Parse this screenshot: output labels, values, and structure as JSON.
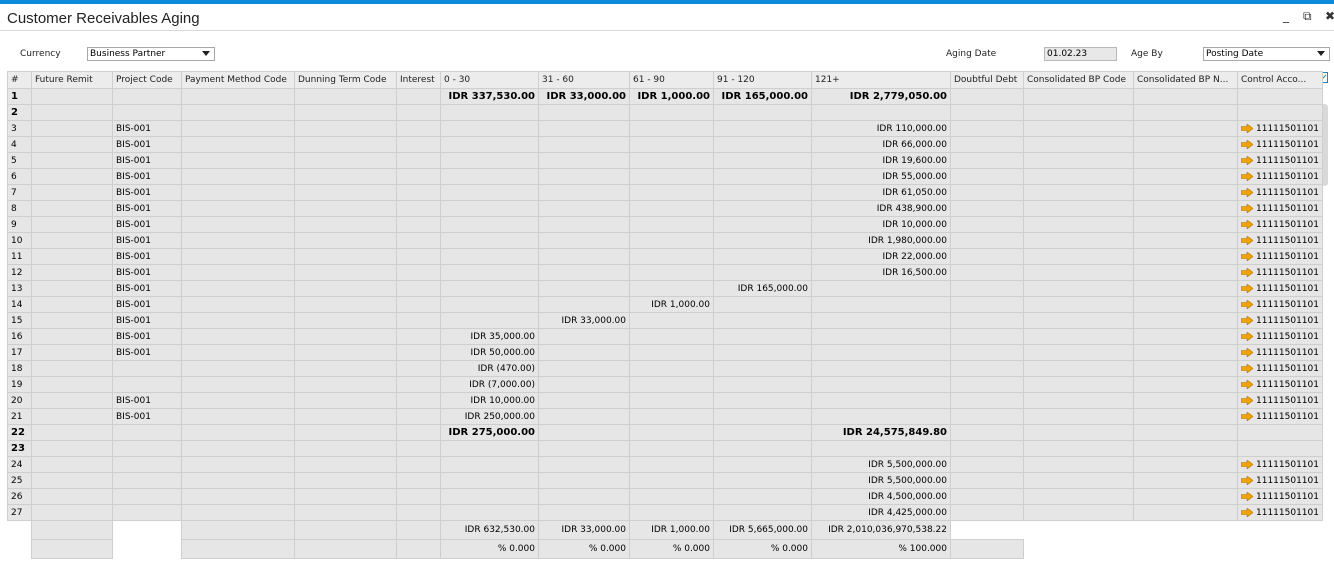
{
  "window": {
    "title": "Customer Receivables Aging",
    "minimize": "_",
    "restore": "⧉",
    "close": "✖"
  },
  "filters": {
    "currency_label": "Currency",
    "currency_value": "Business Partner",
    "aging_date_label": "Aging Date",
    "aging_date_value": "01.02.23",
    "age_by_label": "Age By",
    "age_by_value": "Posting Date"
  },
  "grid": {
    "columns": [
      "#",
      "Future Remit",
      "Project Code",
      "Payment Method Code",
      "Dunning Term Code",
      "Interest",
      "0 - 30",
      "31 - 60",
      "61 - 90",
      "91 - 120",
      "121+",
      "Doubtful Debt",
      "Consolidated BP Code",
      "Consolidated BP N...",
      "Control Acco..."
    ],
    "rows": [
      {
        "n": "1",
        "proj": "",
        "c0": "IDR 337,530.00",
        "c31": "IDR 33,000.00",
        "c61": "IDR 1,000.00",
        "c91": "IDR 165,000.00",
        "c121": "IDR 2,779,050.00",
        "ctrl": "",
        "bold": true
      },
      {
        "n": "2",
        "proj": "",
        "c0": "",
        "c31": "",
        "c61": "",
        "c91": "",
        "c121": "",
        "ctrl": "",
        "bold": true
      },
      {
        "n": "3",
        "proj": "BIS-001",
        "c0": "",
        "c31": "",
        "c61": "",
        "c91": "",
        "c121": "IDR 110,000.00",
        "ctrl": "11111501101"
      },
      {
        "n": "4",
        "proj": "BIS-001",
        "c0": "",
        "c31": "",
        "c61": "",
        "c91": "",
        "c121": "IDR 66,000.00",
        "ctrl": "11111501101"
      },
      {
        "n": "5",
        "proj": "BIS-001",
        "c0": "",
        "c31": "",
        "c61": "",
        "c91": "",
        "c121": "IDR 19,600.00",
        "ctrl": "11111501101"
      },
      {
        "n": "6",
        "proj": "BIS-001",
        "c0": "",
        "c31": "",
        "c61": "",
        "c91": "",
        "c121": "IDR 55,000.00",
        "ctrl": "11111501101"
      },
      {
        "n": "7",
        "proj": "BIS-001",
        "c0": "",
        "c31": "",
        "c61": "",
        "c91": "",
        "c121": "IDR 61,050.00",
        "ctrl": "11111501101"
      },
      {
        "n": "8",
        "proj": "BIS-001",
        "c0": "",
        "c31": "",
        "c61": "",
        "c91": "",
        "c121": "IDR 438,900.00",
        "ctrl": "11111501101"
      },
      {
        "n": "9",
        "proj": "BIS-001",
        "c0": "",
        "c31": "",
        "c61": "",
        "c91": "",
        "c121": "IDR 10,000.00",
        "ctrl": "11111501101"
      },
      {
        "n": "10",
        "proj": "BIS-001",
        "c0": "",
        "c31": "",
        "c61": "",
        "c91": "",
        "c121": "IDR 1,980,000.00",
        "ctrl": "11111501101"
      },
      {
        "n": "11",
        "proj": "BIS-001",
        "c0": "",
        "c31": "",
        "c61": "",
        "c91": "",
        "c121": "IDR 22,000.00",
        "ctrl": "11111501101"
      },
      {
        "n": "12",
        "proj": "BIS-001",
        "c0": "",
        "c31": "",
        "c61": "",
        "c91": "",
        "c121": "IDR 16,500.00",
        "ctrl": "11111501101"
      },
      {
        "n": "13",
        "proj": "BIS-001",
        "c0": "",
        "c31": "",
        "c61": "",
        "c91": "IDR 165,000.00",
        "c121": "",
        "ctrl": "11111501101"
      },
      {
        "n": "14",
        "proj": "BIS-001",
        "c0": "",
        "c31": "",
        "c61": "IDR 1,000.00",
        "c91": "",
        "c121": "",
        "ctrl": "11111501101"
      },
      {
        "n": "15",
        "proj": "BIS-001",
        "c0": "",
        "c31": "IDR 33,000.00",
        "c61": "",
        "c91": "",
        "c121": "",
        "ctrl": "11111501101"
      },
      {
        "n": "16",
        "proj": "BIS-001",
        "c0": "IDR 35,000.00",
        "c31": "",
        "c61": "",
        "c91": "",
        "c121": "",
        "ctrl": "11111501101"
      },
      {
        "n": "17",
        "proj": "BIS-001",
        "c0": "IDR 50,000.00",
        "c31": "",
        "c61": "",
        "c91": "",
        "c121": "",
        "ctrl": "11111501101"
      },
      {
        "n": "18",
        "proj": "",
        "c0": "IDR (470.00)",
        "c31": "",
        "c61": "",
        "c91": "",
        "c121": "",
        "ctrl": "11111501101"
      },
      {
        "n": "19",
        "proj": "",
        "c0": "IDR (7,000.00)",
        "c31": "",
        "c61": "",
        "c91": "",
        "c121": "",
        "ctrl": "11111501101"
      },
      {
        "n": "20",
        "proj": "BIS-001",
        "c0": "IDR 10,000.00",
        "c31": "",
        "c61": "",
        "c91": "",
        "c121": "",
        "ctrl": "11111501101"
      },
      {
        "n": "21",
        "proj": "BIS-001",
        "c0": "IDR 250,000.00",
        "c31": "",
        "c61": "",
        "c91": "",
        "c121": "",
        "ctrl": "11111501101"
      },
      {
        "n": "22",
        "proj": "",
        "c0": "IDR 275,000.00",
        "c31": "",
        "c61": "",
        "c91": "",
        "c121": "IDR 24,575,849.80",
        "ctrl": "",
        "bold": true
      },
      {
        "n": "23",
        "proj": "",
        "c0": "",
        "c31": "",
        "c61": "",
        "c91": "",
        "c121": "",
        "ctrl": "",
        "bold": true
      },
      {
        "n": "24",
        "proj": "",
        "c0": "",
        "c31": "",
        "c61": "",
        "c91": "",
        "c121": "IDR 5,500,000.00",
        "ctrl": "11111501101"
      },
      {
        "n": "25",
        "proj": "",
        "c0": "",
        "c31": "",
        "c61": "",
        "c91": "",
        "c121": "IDR 5,500,000.00",
        "ctrl": "11111501101"
      },
      {
        "n": "26",
        "proj": "",
        "c0": "",
        "c31": "",
        "c61": "",
        "c91": "",
        "c121": "IDR 4,500,000.00",
        "ctrl": "11111501101"
      },
      {
        "n": "27",
        "proj": "",
        "c0": "",
        "c31": "",
        "c61": "",
        "c91": "",
        "c121": "IDR 4,425,000.00",
        "ctrl": "11111501101"
      }
    ],
    "totals": {
      "amounts": [
        "IDR 632,530.00",
        "IDR 33,000.00",
        "IDR 1,000.00",
        "IDR 5,665,000.00",
        "IDR 2,010,036,970,538.22"
      ],
      "percents": [
        "% 0.000",
        "% 0.000",
        "% 0.000",
        "% 0.000",
        "% 100.000"
      ]
    }
  },
  "colors": {
    "accent": "#0a8ad8",
    "link_arrow": "#f0a500"
  },
  "icons": {
    "control_account_link": "orange-link-arrow-icon",
    "expand": "expand-icon"
  }
}
